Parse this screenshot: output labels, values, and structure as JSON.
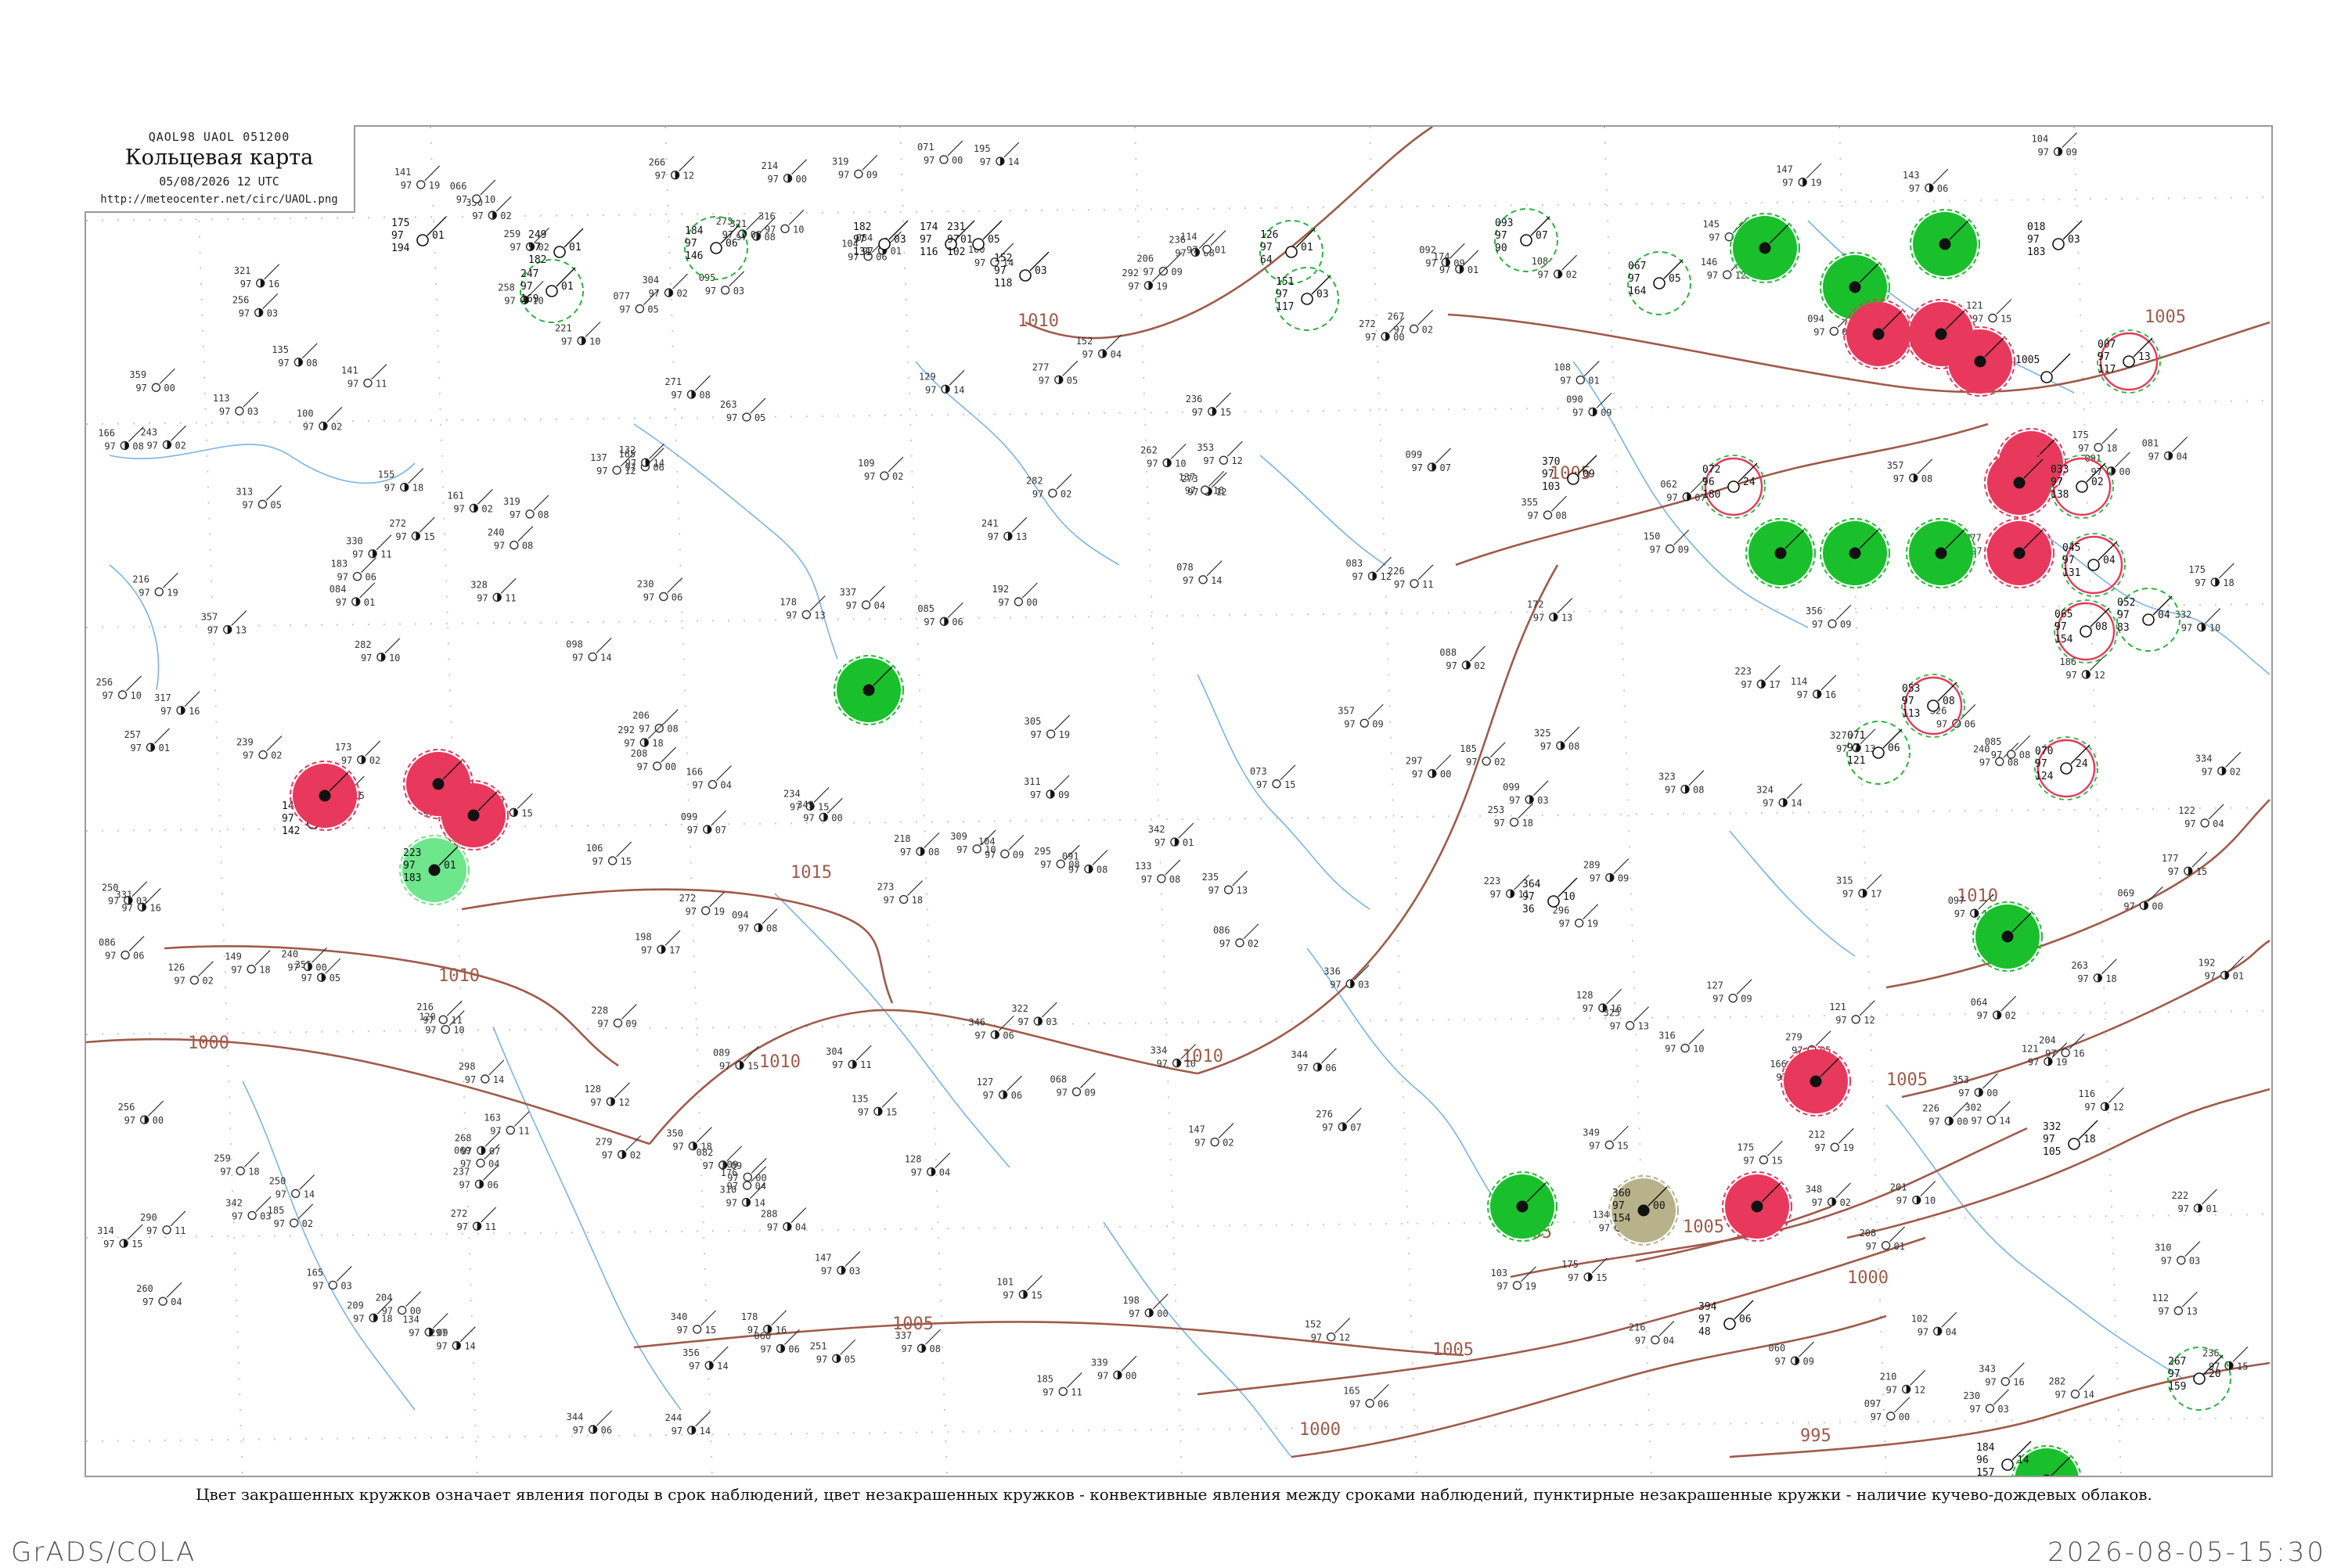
{
  "header": {
    "code_line": "QAOL98  UAOL  051200",
    "title": "Кольцевая карта",
    "date": "05/08/2026 12 UTC",
    "url": "http://meteocenter.net/circ/UAOL.png"
  },
  "caption": "Цвет закрашенных кружков означает явления погоды в срок наблюдений, цвет незакрашенных кружков - конвективные явления между сроками наблюдений, пунктирные незакрашенные кружки - наличие кучево-дождевых облаков.",
  "footer": {
    "left": "GrADS/COLA",
    "right": "2026-08-05-15:30"
  },
  "colors": {
    "thunder": "#e8385c",
    "rain": "#19c02c",
    "showers": "#6ee68c",
    "haze": "#b7b28a",
    "isobar": "#a05a4a",
    "river": "#5aa0e0",
    "cb_ring": "#28b43c"
  },
  "isobars": [
    {
      "label": "1005",
      "kind": "isobar"
    },
    {
      "label": "1010",
      "kind": "isobar"
    },
    {
      "label": "1005",
      "kind": "isobar"
    },
    {
      "label": "1000",
      "kind": "isobar"
    },
    {
      "label": "1010",
      "kind": "isobar"
    },
    {
      "label": "1010",
      "kind": "isobar"
    },
    {
      "label": "1015",
      "kind": "isobar"
    },
    {
      "label": "1010",
      "kind": "isobar"
    },
    {
      "label": "1005",
      "kind": "isobar"
    },
    {
      "label": "1005",
      "kind": "isobar"
    },
    {
      "label": "1000",
      "kind": "isobar"
    },
    {
      "label": "995",
      "kind": "isobar"
    },
    {
      "label": "1005",
      "kind": "isobar"
    },
    {
      "label": "1010",
      "kind": "isobar"
    },
    {
      "label": "1005",
      "kind": "isobar"
    },
    {
      "label": "1000",
      "kind": "isobar"
    },
    {
      "label": "1005",
      "kind": "isobar"
    }
  ],
  "stations": [
    {
      "p": "175",
      "t": "97",
      "d": "01",
      "c": "194",
      "kind": "none"
    },
    {
      "p": "247",
      "t": "97",
      "d": "01",
      "c": "169",
      "kind": "cb"
    },
    {
      "p": "249",
      "t": "97",
      "d": "01",
      "c": "182",
      "kind": "none"
    },
    {
      "p": "184",
      "t": "97",
      "d": "06",
      "c": "146",
      "kind": "cb"
    },
    {
      "p": "182",
      "t": "97",
      "d": "03",
      "c": "131",
      "kind": "none"
    },
    {
      "p": "174",
      "t": "97",
      "d": "01",
      "c": "116",
      "kind": "none"
    },
    {
      "p": "231",
      "t": "97",
      "d": "05",
      "c": "102",
      "kind": "none"
    },
    {
      "p": "152",
      "t": "97",
      "d": "03",
      "c": "118",
      "kind": "none"
    },
    {
      "p": "126",
      "t": "97",
      "d": "01",
      "c": "64",
      "kind": "cb"
    },
    {
      "p": "151",
      "t": "97",
      "d": "03",
      "c": "117",
      "kind": "cb"
    },
    {
      "p": "093",
      "t": "97",
      "d": "07",
      "c": "90",
      "kind": "cb"
    },
    {
      "p": "067",
      "t": "97",
      "d": "05",
      "c": "164",
      "kind": "cb"
    },
    {
      "p": "",
      "t": "",
      "d": "",
      "c": "",
      "kind": "rain"
    },
    {
      "p": "",
      "t": "",
      "d": "",
      "c": "",
      "kind": "rain"
    },
    {
      "p": "",
      "t": "",
      "d": "",
      "c": "",
      "kind": "rain"
    },
    {
      "p": "018",
      "t": "97",
      "d": "03",
      "c": "183",
      "kind": "none"
    },
    {
      "p": "",
      "t": "",
      "d": "",
      "c": "",
      "kind": "thunder"
    },
    {
      "p": "",
      "t": "",
      "d": "",
      "c": "",
      "kind": "thunder"
    },
    {
      "p": "",
      "t": "",
      "d": "",
      "c": "",
      "kind": "thunder"
    },
    {
      "p": "007",
      "t": "97",
      "d": "13",
      "c": "117",
      "kind": "thunder-open"
    },
    {
      "p": "1005",
      "t": "",
      "d": "",
      "c": "",
      "kind": "none"
    },
    {
      "p": "",
      "t": "",
      "d": "",
      "c": "",
      "kind": "thunder"
    },
    {
      "p": "",
      "t": "",
      "d": "",
      "c": "",
      "kind": "thunder"
    },
    {
      "p": "072",
      "t": "96",
      "d": "24",
      "c": "180",
      "kind": "thunder-open"
    },
    {
      "p": "033",
      "t": "97",
      "d": "02",
      "c": "138",
      "kind": "thunder-open"
    },
    {
      "p": "",
      "t": "",
      "d": "",
      "c": "",
      "kind": "rain"
    },
    {
      "p": "",
      "t": "",
      "d": "",
      "c": "",
      "kind": "rain"
    },
    {
      "p": "",
      "t": "",
      "d": "",
      "c": "",
      "kind": "rain"
    },
    {
      "p": "",
      "t": "",
      "d": "",
      "c": "",
      "kind": "thunder"
    },
    {
      "p": "045",
      "t": "97",
      "d": "04",
      "c": "131",
      "kind": "thunder-open"
    },
    {
      "p": "052",
      "t": "97",
      "d": "04",
      "c": "83",
      "kind": "cb"
    },
    {
      "p": "065",
      "t": "97",
      "d": "08",
      "c": "154",
      "kind": "thunder-open"
    },
    {
      "p": "053",
      "t": "97",
      "d": "08",
      "c": "113",
      "kind": "thunder-open"
    },
    {
      "p": "071",
      "t": "97",
      "d": "06",
      "c": "121",
      "kind": "cb"
    },
    {
      "p": "070",
      "t": "97",
      "d": "24",
      "c": "124",
      "kind": "thunder-open"
    },
    {
      "p": "",
      "t": "",
      "d": "",
      "c": "",
      "kind": "rain"
    },
    {
      "p": "140",
      "t": "97",
      "d": "01",
      "c": "142",
      "kind": "none"
    },
    {
      "p": "",
      "t": "",
      "d": "",
      "c": "",
      "kind": "thunder"
    },
    {
      "p": "",
      "t": "",
      "d": "",
      "c": "",
      "kind": "thunder"
    },
    {
      "p": "",
      "t": "",
      "d": "",
      "c": "",
      "kind": "thunder"
    },
    {
      "p": "223",
      "t": "97",
      "d": "01",
      "c": "183",
      "kind": "showers"
    },
    {
      "p": "",
      "t": "",
      "d": "",
      "c": "",
      "kind": "rain"
    },
    {
      "p": "",
      "t": "",
      "d": "",
      "c": "",
      "kind": "thunder"
    },
    {
      "p": "",
      "t": "",
      "d": "",
      "c": "",
      "kind": "thunder"
    },
    {
      "p": "",
      "t": "",
      "d": "",
      "c": "",
      "kind": "rain"
    },
    {
      "p": "360",
      "t": "97",
      "d": "00",
      "c": "154",
      "kind": "haze"
    },
    {
      "p": "",
      "t": "",
      "d": "",
      "c": "",
      "kind": "rain"
    },
    {
      "p": "184",
      "t": "96",
      "d": "14",
      "c": "157",
      "kind": "none"
    },
    {
      "p": "332",
      "t": "97",
      "d": "18",
      "c": "105",
      "kind": "none"
    },
    {
      "p": "364",
      "t": "97",
      "d": "10",
      "c": "36",
      "kind": "none"
    },
    {
      "p": "370",
      "t": "97",
      "d": "09",
      "c": "103",
      "kind": "none"
    },
    {
      "p": "394",
      "t": "97",
      "d": "06",
      "c": "48",
      "kind": "none"
    },
    {
      "p": "267",
      "t": "97",
      "d": "20",
      "c": "159",
      "kind": "cb"
    }
  ]
}
